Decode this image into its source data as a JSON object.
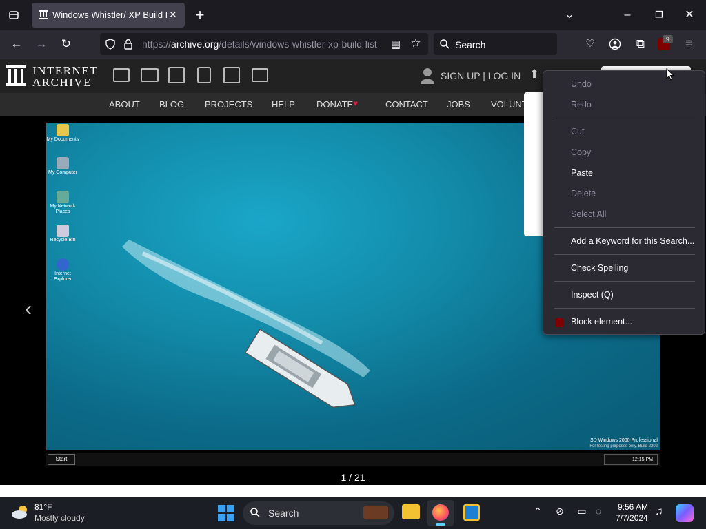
{
  "browser": {
    "tab_title": "Windows Whistler/ XP Build List",
    "url_prefix": "https://",
    "url_domain": "archive.org",
    "url_path": "/details/windows-whistler-xp-build-list",
    "search_placeholder": "Search",
    "ublock_count": "9"
  },
  "ia": {
    "logo_line1": "INTERNET",
    "logo_line2": "ARCHIVE",
    "signup": "SIGN UP | LOG IN",
    "nav": [
      "ABOUT",
      "BLOG",
      "PROJECTS",
      "HELP",
      "DONATE",
      "CONTACT",
      "JOBS",
      "VOLUNT"
    ]
  },
  "viewer": {
    "pager": "1 / 21",
    "desktop_icons": [
      "My Documents",
      "My Computer",
      "My Network Places",
      "Recycle Bin",
      "Internet Explorer"
    ],
    "watermark1": "SD Windows 2000 Professional",
    "watermark2": "For testing purposes only. Build 2202",
    "start_label": "Start",
    "w2k_clock": "12:15 PM"
  },
  "context_menu": {
    "items": [
      {
        "label": "Undo",
        "enabled": false
      },
      {
        "label": "Redo",
        "enabled": false
      },
      {
        "label": "Cut",
        "enabled": false
      },
      {
        "label": "Copy",
        "enabled": false
      },
      {
        "label": "Paste",
        "enabled": true
      },
      {
        "label": "Delete",
        "enabled": false
      },
      {
        "label": "Select All",
        "enabled": false
      },
      {
        "label": "Add a Keyword for this Search...",
        "enabled": true
      },
      {
        "label": "Check Spelling",
        "enabled": true
      },
      {
        "label": "Inspect (Q)",
        "enabled": true
      },
      {
        "label": "Block element...",
        "enabled": true
      }
    ]
  },
  "taskbar": {
    "weather_temp": "81°F",
    "weather_desc": "Mostly cloudy",
    "search_placeholder": "Search",
    "time": "9:56 AM",
    "date": "7/7/2024"
  },
  "colors": {
    "accent_red": "#e11d48",
    "ublock_red": "#800000"
  }
}
